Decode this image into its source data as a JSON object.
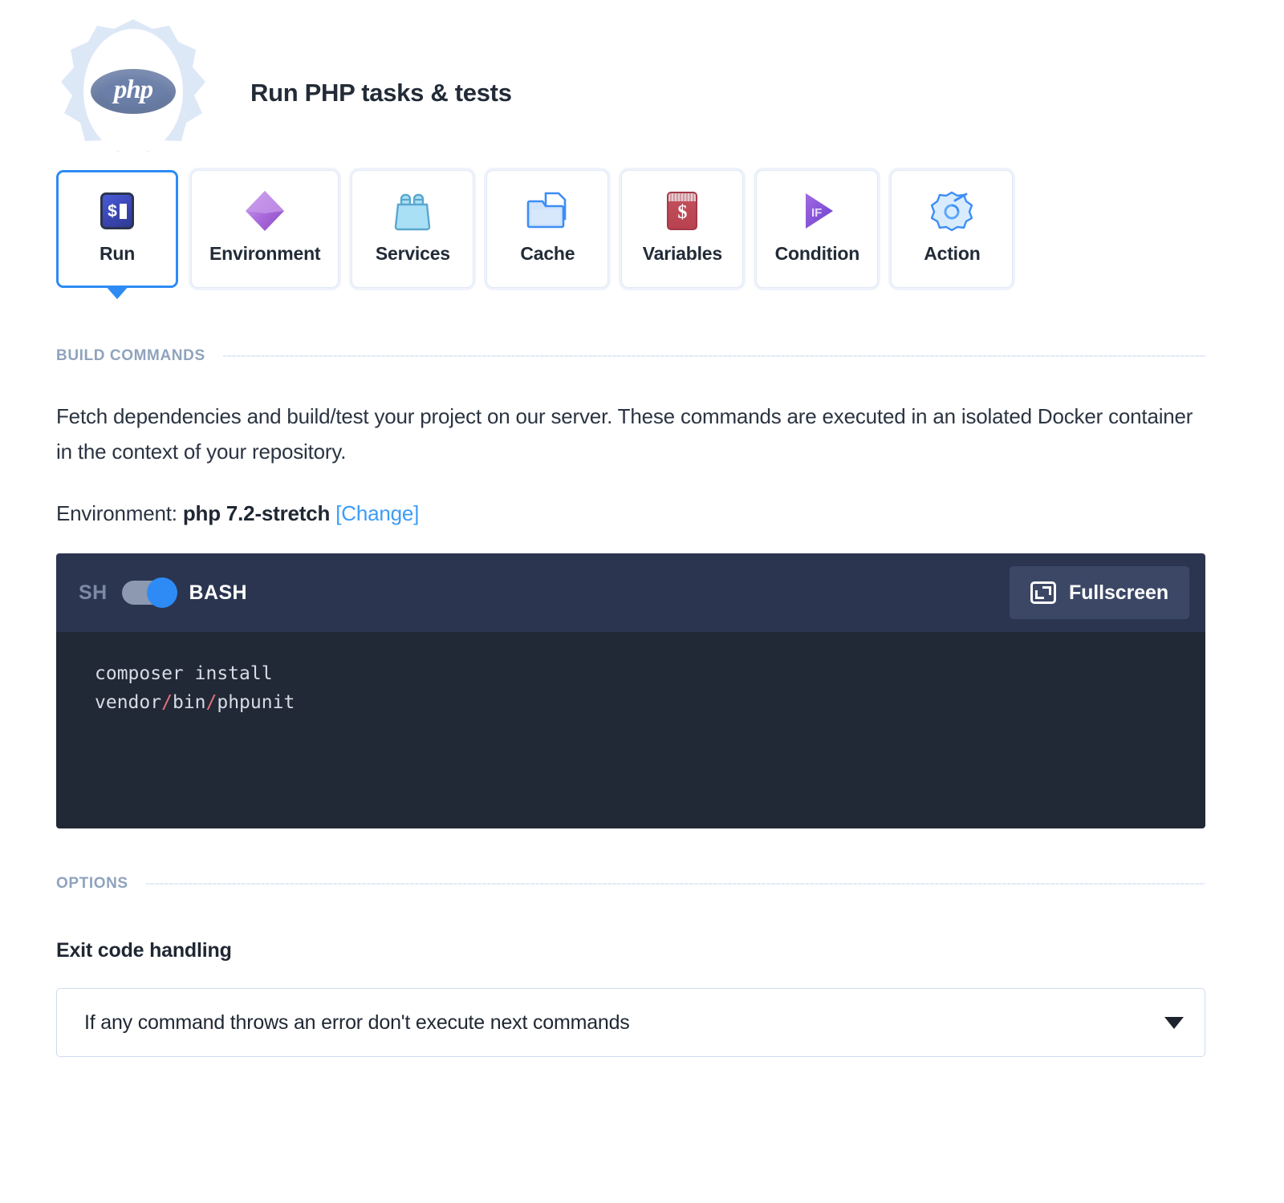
{
  "header": {
    "title": "Run PHP tasks & tests",
    "logo_text": "php",
    "logo_icon": "php-gear-logo"
  },
  "tabs": [
    {
      "label": "Run",
      "icon": "terminal-prompt-icon",
      "active": true
    },
    {
      "label": "Environment",
      "icon": "purple-diamond-icon",
      "active": false
    },
    {
      "label": "Services",
      "icon": "bottle-crate-icon",
      "active": false
    },
    {
      "label": "Cache",
      "icon": "folder-file-icon",
      "active": false
    },
    {
      "label": "Variables",
      "icon": "dollar-card-icon",
      "active": false
    },
    {
      "label": "Condition",
      "icon": "if-play-icon",
      "active": false
    },
    {
      "label": "Action",
      "icon": "gear-swirl-icon",
      "active": false
    }
  ],
  "build_commands": {
    "section_title": "BUILD COMMANDS",
    "description": "Fetch dependencies and build/test your project on our server. These commands are executed in an isolated Docker container in the context of your repository.",
    "environment_prefix": "Environment:",
    "environment_value": "php 7.2-stretch",
    "change_link": "[Change]"
  },
  "editor": {
    "left_toggle_label": "SH",
    "right_toggle_label": "BASH",
    "toggle_state": "BASH",
    "fullscreen_label": "Fullscreen",
    "fullscreen_icon": "expand-icon",
    "code_lines": [
      {
        "text": "composer install",
        "parts": [
          {
            "t": "composer install",
            "c": "plain"
          }
        ]
      },
      {
        "text": "vendor/bin/phpunit",
        "parts": [
          {
            "t": "vendor",
            "c": "plain"
          },
          {
            "t": "/",
            "c": "slash"
          },
          {
            "t": "bin",
            "c": "plain"
          },
          {
            "t": "/",
            "c": "slash"
          },
          {
            "t": "phpunit",
            "c": "plain"
          }
        ]
      }
    ]
  },
  "options": {
    "section_title": "OPTIONS",
    "exit_code_label": "Exit code handling",
    "exit_code_value": "If any command throws an error don't execute next commands"
  },
  "colors": {
    "accent_blue": "#2e8bf5",
    "link_blue": "#3d9cf7",
    "editor_bar": "#2b3550",
    "editor_body": "#212936",
    "section_label": "#8fa3bd",
    "text_dark": "#1f2733"
  }
}
